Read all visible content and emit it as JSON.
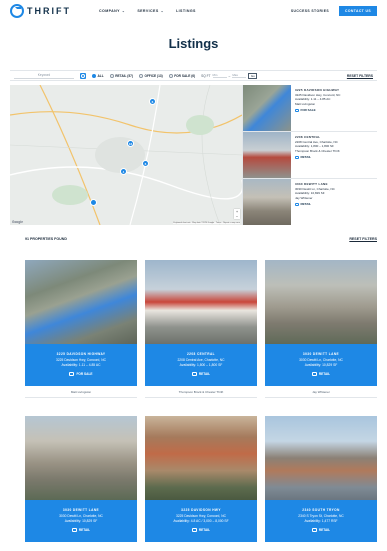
{
  "header": {
    "logo_text": "THRIFT",
    "nav": [
      {
        "label": "COMPANY",
        "dropdown": true
      },
      {
        "label": "SERVICES",
        "dropdown": true
      },
      {
        "label": "LISTINGS",
        "dropdown": false
      }
    ],
    "success_stories": "SUCCESS STORIES",
    "contact_label": "CONTACT US",
    "accent_color": "#1e88e5"
  },
  "page_title": "Listings",
  "filters": {
    "keyword_placeholder": "Keyword",
    "types": [
      {
        "label": "ALL",
        "selected": true
      },
      {
        "label": "RETAIL (57)",
        "selected": false
      },
      {
        "label": "OFFICE (13)",
        "selected": false
      },
      {
        "label": "FOR SALE (6)",
        "selected": false
      }
    ],
    "sqft_label": "SQ FT",
    "min_placeholder": "Min",
    "max_placeholder": "Max",
    "go_label": "Go",
    "reset_label": "RESET FILTERS"
  },
  "map": {
    "pins": [
      "6",
      "16",
      "6",
      "4"
    ],
    "google": "Google",
    "attribution": "Keyboard shortcuts · Map data ©2024 Google · Terms · Report a map error"
  },
  "side_list": [
    {
      "name": "3225 DAVIDSON HIGHWAY",
      "addr": "3225 Davidson Hwy, Concord, NC",
      "avail": "Availability: 1.11 – 4.85 AC",
      "agent": "Matt Livingston",
      "type": "FOR SALE"
    },
    {
      "name": "2208 CENTRAL",
      "addr": "2208 Central Ave, Charlotte, NC",
      "avail": "Availability: 1,800 – 1,800 SF",
      "agent": "Thompson Brock & Chester Thrift",
      "type": "RETAIL"
    },
    {
      "name": "3030 DEWITT LANE",
      "addr": "3030 Dewitt Ln, Charlotte, NC",
      "avail": "Availability: 10,829 SF",
      "agent": "Jay Whitener",
      "type": "RETAIL"
    }
  ],
  "results": {
    "count_label": "91 PROPERTIES FOUND",
    "reset_label": "RESET FILTERS"
  },
  "cards": [
    {
      "name": "3225 DAVIDSON HIGHWAY",
      "addr": "3225 Davidson Hwy, Concord, NC",
      "avail": "Availability: 1.11 – 4.85 AC",
      "type": "FOR SALE",
      "agent": "Matt Livingston"
    },
    {
      "name": "2208 CENTRAL",
      "addr": "2208 Central Ave, Charlotte, NC",
      "avail": "Availability: 1,800 – 1,800 SF",
      "type": "RETAIL",
      "agent": "Thompson Brock & Chester Thrift"
    },
    {
      "name": "3030 DEWITT LANE",
      "addr": "3030 Dewitt Ln, Charlotte, NC",
      "avail": "Availability: 10,829 SF",
      "type": "RETAIL",
      "agent": "Jay Whitener"
    },
    {
      "name": "3030 DEWITT LANE",
      "addr": "3030 Dewitt Ln, Charlotte, NC",
      "avail": "Availability: 10,829 SF",
      "type": "RETAIL",
      "agent": ""
    },
    {
      "name": "3225 DAVIDSON HWY",
      "addr": "3225 Davidson Hwy, Concord, NC",
      "avail": "Availability: 4.8 AC / 3,000 – 8,000 SF",
      "type": "RETAIL",
      "agent": ""
    },
    {
      "name": "2340 SOUTH TRYON",
      "addr": "2340 S Tryon St, Charlotte, NC",
      "avail": "Availability: 1,477 RSF",
      "type": "RETAIL",
      "agent": ""
    }
  ]
}
